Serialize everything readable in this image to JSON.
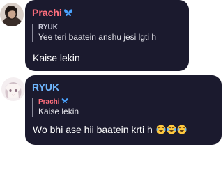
{
  "messages": [
    {
      "author": "Prachi",
      "author_color": "#ff6f7d",
      "author_badge_icon": "butterfly-icon",
      "quote": {
        "author": "RYUK",
        "author_color": "#c8c8d8",
        "text": "Yee teri baatein anshu jesi lgti h"
      },
      "text": "Kaise lekin",
      "emojis": []
    },
    {
      "author": "RYUK",
      "author_color": "#6fb6ff",
      "author_badge_icon": "",
      "quote": {
        "author": "Prachi",
        "author_color": "#ff6f7d",
        "badge_icon": "butterfly-icon",
        "text": "Kaise lekin"
      },
      "text": "Wo bhi ase hii baatein krti h",
      "emojis": [
        "laughing-tears-emoji",
        "laughing-tears-emoji",
        "laughing-tears-emoji"
      ]
    }
  ],
  "colors": {
    "bubble_bg": "#1b1a2e",
    "butterfly": "#4aa3ff"
  }
}
